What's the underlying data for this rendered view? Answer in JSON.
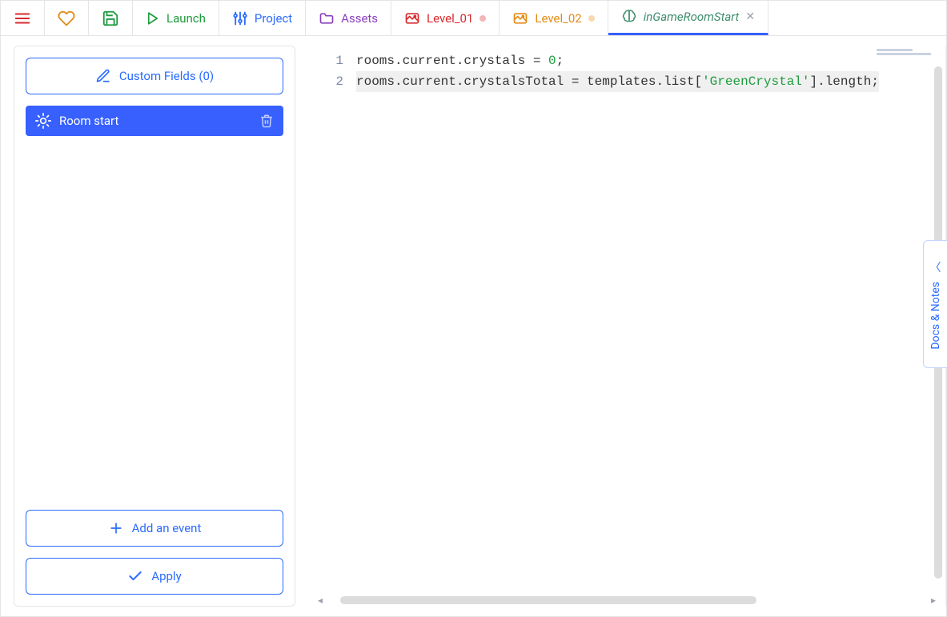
{
  "topbar": {
    "launch_label": "Launch",
    "project_label": "Project",
    "assets_label": "Assets"
  },
  "tabs": [
    {
      "label": "Level_01",
      "color": "#d8292e",
      "dot": "#f3b6b8",
      "active": false
    },
    {
      "label": "Level_02",
      "color": "#e38b16",
      "dot": "#f5d9b2",
      "active": false
    },
    {
      "label": "inGameRoomStart",
      "color": "#3e8e6e",
      "italic": true,
      "closeable": true,
      "active": true
    }
  ],
  "sidebar": {
    "custom_fields_label": "Custom Fields (0)",
    "events": [
      {
        "label": "Room start"
      }
    ],
    "add_event_label": "Add an event",
    "apply_label": "Apply"
  },
  "editor": {
    "lines": [
      {
        "num": "1",
        "tokens": [
          {
            "t": "rooms.current.crystals = "
          },
          {
            "t": "0",
            "cls": "tok-num"
          },
          {
            "t": ";"
          }
        ],
        "highlight": false
      },
      {
        "num": "2",
        "tokens": [
          {
            "t": "rooms.current.crystalsTotal = templates.list["
          },
          {
            "t": "'GreenCrystal'",
            "cls": "tok-str"
          },
          {
            "t": "].length;"
          }
        ],
        "highlight": true
      }
    ]
  },
  "docs_tab": {
    "label": "Docs & Notes"
  }
}
